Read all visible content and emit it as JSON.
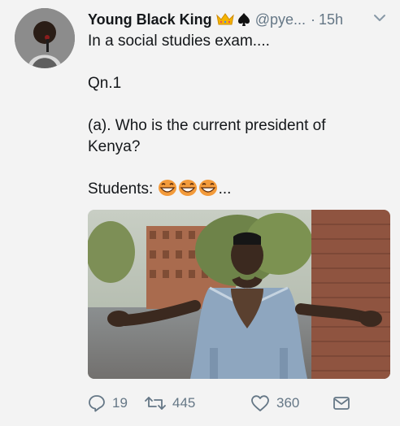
{
  "user": {
    "display_name": "Young Black King",
    "handle": "@pye...",
    "dot": "·",
    "time": "15h"
  },
  "tweet": {
    "line1": "In a social studies exam....",
    "line2": "Qn.1",
    "line3": "(a). Who is the current president of Kenya?",
    "line4_prefix": "Students:",
    "line4_suffix": "..."
  },
  "actions": {
    "reply_count": "19",
    "retweet_count": "445",
    "like_count": "360"
  },
  "icons": {
    "crown": "crown-icon",
    "spade": "spade-icon",
    "caret": "chevron-down-icon",
    "emoji": "grinning-face-icon",
    "reply": "reply-icon",
    "retweet": "retweet-icon",
    "like": "heart-icon",
    "dm": "direct-message-icon"
  },
  "colors": {
    "text": "#14171a",
    "muted": "#657786",
    "background": "#f3f3f3"
  }
}
